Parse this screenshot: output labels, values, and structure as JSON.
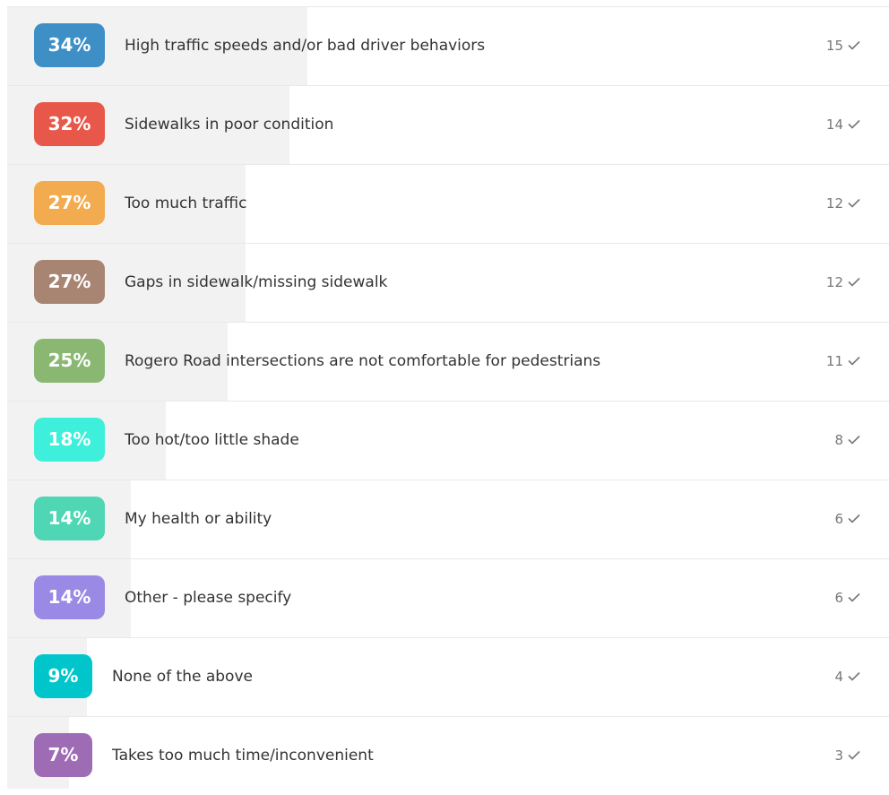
{
  "chart_data": {
    "type": "bar",
    "orientation": "horizontal",
    "title": "",
    "xlim": [
      0,
      100
    ],
    "categories": [
      "High traffic speeds and/or bad driver behaviors",
      "Sidewalks in poor condition",
      "Too much traffic",
      "Gaps in sidewalk/missing sidewalk",
      "Rogero Road intersections are not comfortable for pedestrians",
      "Too hot/too little shade",
      "My health or ability",
      "Other - please specify",
      "None of the above",
      "Takes too much time/inconvenient"
    ],
    "percent_labels": [
      "34%",
      "32%",
      "27%",
      "27%",
      "25%",
      "18%",
      "14%",
      "14%",
      "9%",
      "7%"
    ],
    "values": [
      34,
      32,
      27,
      27,
      25,
      18,
      14,
      14,
      9,
      7
    ],
    "counts": [
      "15",
      "14",
      "12",
      "12",
      "11",
      "8",
      "6",
      "6",
      "4",
      "3"
    ],
    "badge_colors": [
      "#3d8fc6",
      "#e8584a",
      "#f2ab4e",
      "#a88573",
      "#8ab873",
      "#3ef0db",
      "#4fd6b4",
      "#9a8ae5",
      "#00c6cb",
      "#9e6cb4"
    ],
    "fill_color": "#f2f2f2",
    "check_icon": "check-icon"
  }
}
